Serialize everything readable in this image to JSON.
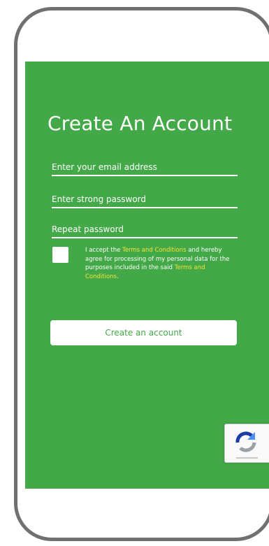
{
  "form": {
    "title": "Create An Account",
    "email_placeholder": "Enter your email address",
    "password_placeholder": "Enter strong password",
    "repeat_placeholder": "Repeat password",
    "terms": {
      "text_1": "I accept the ",
      "link_1": "Terms and Conditions",
      "text_2": " and hereby agree for processing of my personal data for the purposes included in the said ",
      "link_2": "Terms and Conditions",
      "text_3": "."
    },
    "submit_label": "Create an account"
  },
  "recaptcha": {
    "icon": "recaptcha-icon"
  },
  "colors": {
    "background": "#43a847",
    "link": "#f5e23a",
    "frame": "#707070"
  }
}
